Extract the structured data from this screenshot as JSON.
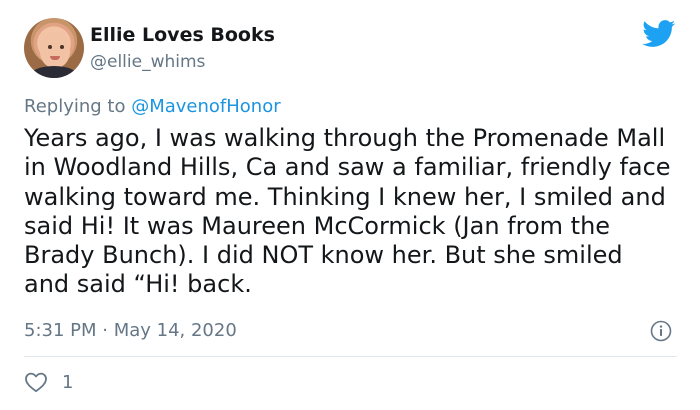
{
  "tweet": {
    "author": {
      "display_name": "Ellie Loves Books",
      "handle": "@ellie_whims",
      "avatar_icon": "user-avatar"
    },
    "replying_to_prefix": "Replying to ",
    "replying_to_handle": "@MavenofHonor",
    "text": "Years ago, I was walking through the Promenade Mall in Woodland Hills, Ca and saw a familiar, friendly face walking toward me. Thinking I knew her, I smiled and said Hi! It was Maureen McCormick (Jan from the Brady Bunch). I did NOT know her. But she smiled and said “Hi! back.",
    "timestamp": "5:31 PM · May 14, 2020",
    "like_count": "1",
    "icons": {
      "brand": "twitter-bird-icon",
      "info": "info-icon",
      "like": "heart-icon"
    },
    "colors": {
      "brand_blue": "#1da1f2",
      "link_blue": "#1b95e0",
      "muted_gray": "#657786",
      "text": "#14171a"
    }
  }
}
